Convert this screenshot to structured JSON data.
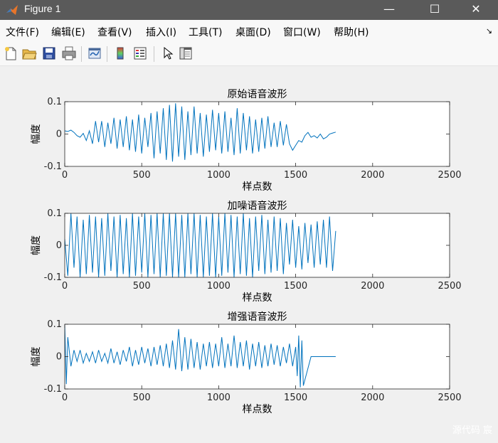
{
  "window": {
    "title": "Figure 1",
    "minimize_glyph": "—",
    "maximize_glyph": "☐",
    "close_glyph": "✕"
  },
  "menu": {
    "items": [
      "文件(F)",
      "编辑(E)",
      "查看(V)",
      "插入(I)",
      "工具(T)",
      "桌面(D)",
      "窗口(W)",
      "帮助(H)"
    ],
    "overflow_glyph": "↘"
  },
  "toolbar": {
    "icons": [
      "new-figure-icon",
      "open-file-icon",
      "save-icon",
      "print-icon",
      "link-plot-icon",
      "insert-colorbar-icon",
      "insert-legend-icon",
      "pointer-icon",
      "property-editor-icon"
    ]
  },
  "watermark": "源代码 宸",
  "colors": {
    "line": "#0072bd",
    "axes_bg": "#ffffff",
    "figure_bg": "#f0f0f0"
  },
  "chart_data": [
    {
      "type": "line",
      "title": "原始语音波形",
      "xlabel": "样点数",
      "ylabel": "幅度",
      "xlim": [
        0,
        2500
      ],
      "ylim": [
        -0.1,
        0.1
      ],
      "xticks": [
        0,
        500,
        1000,
        1500,
        2000,
        2500
      ],
      "yticks": [
        -0.1,
        0,
        0.1
      ],
      "xtick_labels": [
        "0",
        "500",
        "1000",
        "1500",
        "2000",
        "2500"
      ],
      "ytick_labels": [
        "-0.1",
        "0",
        "0.1"
      ],
      "grid": false,
      "series": [
        {
          "x": [
            0,
            20,
            40,
            60,
            80,
            100,
            120,
            140,
            160,
            180,
            200,
            220,
            240,
            260,
            280,
            300,
            320,
            340,
            360,
            380,
            400,
            420,
            440,
            460,
            480,
            500,
            520,
            540,
            560,
            580,
            600,
            620,
            640,
            660,
            680,
            700,
            720,
            740,
            760,
            780,
            800,
            820,
            840,
            860,
            880,
            900,
            920,
            940,
            960,
            980,
            1000,
            1020,
            1040,
            1060,
            1080,
            1100,
            1120,
            1140,
            1160,
            1180,
            1200,
            1220,
            1240,
            1260,
            1280,
            1300,
            1320,
            1340,
            1360,
            1380,
            1400,
            1420,
            1440,
            1460,
            1480,
            1500,
            1520,
            1540,
            1560,
            1580,
            1600,
            1620,
            1640,
            1660,
            1680,
            1700,
            1720,
            1740,
            1760
          ],
          "y": [
            0.01,
            0.008,
            0.012,
            0.005,
            -0.005,
            -0.01,
            0.002,
            -0.02,
            0.01,
            -0.03,
            0.04,
            -0.025,
            0.04,
            -0.04,
            0.035,
            -0.03,
            0.05,
            -0.045,
            0.045,
            -0.04,
            0.055,
            -0.05,
            0.045,
            -0.055,
            0.06,
            -0.06,
            0.05,
            -0.04,
            0.065,
            -0.075,
            0.07,
            -0.06,
            0.08,
            -0.08,
            0.09,
            -0.085,
            0.095,
            -0.07,
            0.085,
            -0.08,
            0.07,
            -0.065,
            0.085,
            -0.06,
            0.065,
            -0.07,
            0.06,
            -0.055,
            0.075,
            -0.05,
            0.065,
            -0.06,
            0.07,
            -0.055,
            0.05,
            -0.065,
            0.08,
            -0.06,
            0.065,
            -0.05,
            0.055,
            -0.06,
            0.045,
            -0.055,
            0.05,
            -0.045,
            0.055,
            -0.04,
            0.035,
            -0.04,
            0.04,
            -0.035,
            0.03,
            -0.03,
            -0.05,
            -0.035,
            -0.02,
            -0.025,
            -0.005,
            0.005,
            -0.01,
            -0.005,
            -0.012,
            0.0,
            -0.015,
            -0.01,
            0.0,
            0.003,
            0.006
          ]
        }
      ]
    },
    {
      "type": "line",
      "title": "加噪语音波形",
      "xlabel": "样点数",
      "ylabel": "幅度",
      "xlim": [
        0,
        2500
      ],
      "ylim": [
        -0.1,
        0.1
      ],
      "xticks": [
        0,
        500,
        1000,
        1500,
        2000,
        2500
      ],
      "yticks": [
        -0.1,
        0,
        0.1
      ],
      "xtick_labels": [
        "0",
        "500",
        "1000",
        "1500",
        "2000",
        "2500"
      ],
      "ytick_labels": [
        "-0.1",
        "0",
        "0.1"
      ],
      "grid": false,
      "series": [
        {
          "x": [
            0,
            20,
            40,
            60,
            80,
            100,
            120,
            140,
            160,
            180,
            200,
            220,
            240,
            260,
            280,
            300,
            320,
            340,
            360,
            380,
            400,
            420,
            440,
            460,
            480,
            500,
            520,
            540,
            560,
            580,
            600,
            620,
            640,
            660,
            680,
            700,
            720,
            740,
            760,
            780,
            800,
            820,
            840,
            860,
            880,
            900,
            920,
            940,
            960,
            980,
            1000,
            1020,
            1040,
            1060,
            1080,
            1100,
            1120,
            1140,
            1160,
            1180,
            1200,
            1220,
            1240,
            1260,
            1280,
            1300,
            1320,
            1340,
            1360,
            1380,
            1400,
            1420,
            1440,
            1460,
            1480,
            1500,
            1520,
            1540,
            1560,
            1580,
            1600,
            1620,
            1640,
            1660,
            1680,
            1700,
            1720,
            1740,
            1760
          ],
          "y": [
            0.02,
            -0.095,
            0.1,
            -0.07,
            0.09,
            -0.1,
            0.08,
            -0.09,
            0.095,
            -0.085,
            0.09,
            -0.1,
            0.085,
            -0.095,
            0.1,
            -0.08,
            0.09,
            -0.1,
            0.095,
            -0.09,
            0.085,
            -0.1,
            0.1,
            -0.095,
            0.09,
            -0.085,
            0.1,
            -0.1,
            0.095,
            -0.09,
            0.1,
            -0.1,
            0.1,
            -0.095,
            0.1,
            -0.1,
            0.1,
            -0.1,
            0.095,
            -0.1,
            0.1,
            -0.09,
            0.1,
            -0.1,
            0.095,
            -0.1,
            0.09,
            -0.095,
            0.1,
            -0.1,
            0.09,
            -0.095,
            0.1,
            -0.085,
            0.095,
            -0.1,
            0.09,
            -0.09,
            0.1,
            -0.095,
            0.085,
            -0.1,
            0.09,
            -0.08,
            0.095,
            -0.09,
            0.08,
            -0.085,
            0.09,
            -0.08,
            0.085,
            -0.09,
            0.07,
            -0.06,
            0.08,
            -0.07,
            0.06,
            -0.075,
            0.07,
            -0.055,
            0.065,
            -0.07,
            0.075,
            -0.06,
            0.08,
            -0.07,
            0.09,
            -0.08,
            0.045
          ]
        }
      ]
    },
    {
      "type": "line",
      "title": "增强语音波形",
      "xlabel": "样点数",
      "ylabel": "幅度",
      "xlim": [
        0,
        2500
      ],
      "ylim": [
        -0.1,
        0.1
      ],
      "xticks": [
        0,
        500,
        1000,
        1500,
        2000,
        2500
      ],
      "yticks": [
        -0.1,
        0,
        0.1
      ],
      "xtick_labels": [
        "0",
        "500",
        "1000",
        "1500",
        "2000",
        "2500"
      ],
      "ytick_labels": [
        "-0.1",
        "0",
        "0.1"
      ],
      "grid": false,
      "series": [
        {
          "x": [
            0,
            10,
            20,
            40,
            60,
            80,
            100,
            120,
            140,
            160,
            180,
            200,
            220,
            240,
            260,
            280,
            300,
            320,
            340,
            360,
            380,
            400,
            420,
            440,
            460,
            480,
            500,
            520,
            540,
            560,
            580,
            600,
            620,
            640,
            660,
            680,
            700,
            720,
            740,
            760,
            780,
            800,
            820,
            840,
            860,
            880,
            900,
            920,
            940,
            960,
            980,
            1000,
            1020,
            1040,
            1060,
            1080,
            1100,
            1120,
            1140,
            1160,
            1180,
            1200,
            1220,
            1240,
            1260,
            1280,
            1300,
            1320,
            1340,
            1360,
            1380,
            1400,
            1420,
            1440,
            1460,
            1480,
            1500,
            1510,
            1520,
            1530,
            1540,
            1550,
            1600,
            1700,
            1760
          ],
          "y": [
            0.1,
            -0.085,
            0.06,
            -0.03,
            0.02,
            -0.015,
            0.02,
            -0.02,
            0.01,
            -0.015,
            0.015,
            -0.02,
            0.02,
            -0.015,
            0.01,
            -0.02,
            0.025,
            -0.02,
            0.015,
            -0.025,
            0.02,
            -0.015,
            0.03,
            -0.03,
            0.02,
            -0.025,
            0.03,
            -0.02,
            0.025,
            -0.03,
            0.03,
            -0.025,
            0.035,
            -0.03,
            0.04,
            -0.035,
            0.05,
            -0.04,
            0.085,
            -0.045,
            0.06,
            -0.04,
            0.055,
            -0.035,
            0.045,
            -0.04,
            0.04,
            -0.03,
            0.045,
            -0.035,
            0.04,
            -0.03,
            0.06,
            -0.035,
            0.04,
            -0.03,
            0.065,
            -0.035,
            0.045,
            -0.03,
            0.05,
            -0.04,
            0.04,
            -0.03,
            0.045,
            -0.035,
            0.035,
            -0.03,
            0.04,
            -0.025,
            0.035,
            -0.03,
            0.03,
            -0.02,
            0.04,
            -0.03,
            0.03,
            -0.06,
            0.065,
            -0.095,
            0.05,
            -0.09,
            0.0,
            0.0,
            0.0
          ]
        }
      ]
    }
  ]
}
